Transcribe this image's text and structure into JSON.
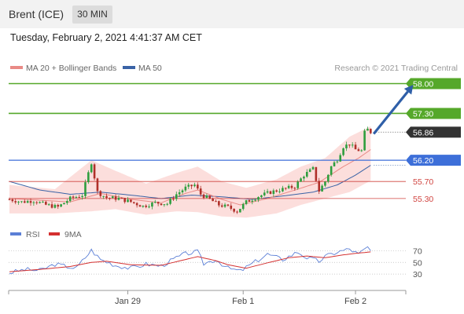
{
  "header": {
    "instrument": "Brent (ICE)",
    "timeframe": "30 MIN"
  },
  "datetime": "Tuesday, February 2, 2021 4:41:37 AM CET",
  "legend": {
    "ma20_bb": "MA 20 + Bollinger Bands",
    "ma50": "MA 50",
    "credit": "Research © 2021 Trading Central"
  },
  "rsi_legend": {
    "rsi": "RSI",
    "ma9": "9MA"
  },
  "colors": {
    "bull": "#2e9e3e",
    "bear": "#b0302a",
    "ma20": "#e98a86",
    "bb_fill": "#fbd8d6",
    "ma50": "#3a63a6",
    "target": "#55a82a",
    "pivot": "#3d6fd9",
    "support": "#d0433f",
    "arrow": "#2f5fa8",
    "rsi": "#5b7fd6",
    "rsi_ma": "#d43030",
    "last_price": "#333333"
  },
  "chart_data": {
    "type": "candlestick",
    "price_axis": {
      "min": 54.8,
      "max": 58.12,
      "grid": false
    },
    "x_ticks": [
      {
        "label": "Jan 29",
        "bar": 39
      },
      {
        "label": "Feb 1",
        "bar": 77
      },
      {
        "label": "Feb 2",
        "bar": 114
      }
    ],
    "levels": [
      {
        "value": 58.0,
        "label": "58.00",
        "kind": "target"
      },
      {
        "value": 57.3,
        "label": "57.30",
        "kind": "target"
      },
      {
        "value": 56.86,
        "label": "56.86",
        "kind": "last"
      },
      {
        "value": 56.2,
        "label": "56.20",
        "kind": "pivot"
      },
      {
        "value": 55.7,
        "label": "55.70",
        "kind": "support"
      },
      {
        "value": 55.3,
        "label": "55.30",
        "kind": "support"
      }
    ],
    "forecast_arrow": {
      "from": {
        "bar": 120,
        "price": 56.82
      },
      "to": {
        "bar": 133,
        "price": 57.97
      }
    },
    "anchors": [
      [
        0,
        55.28
      ],
      [
        4,
        55.22
      ],
      [
        8,
        55.25
      ],
      [
        12,
        55.15
      ],
      [
        16,
        55.1
      ],
      [
        20,
        55.3
      ],
      [
        24,
        55.38
      ],
      [
        27,
        56.15
      ],
      [
        29,
        55.45
      ],
      [
        32,
        55.32
      ],
      [
        36,
        55.3
      ],
      [
        40,
        55.22
      ],
      [
        44,
        55.12
      ],
      [
        48,
        55.2
      ],
      [
        52,
        55.18
      ],
      [
        55,
        55.4
      ],
      [
        58,
        55.55
      ],
      [
        61,
        55.62
      ],
      [
        63,
        55.4
      ],
      [
        66,
        55.28
      ],
      [
        69,
        55.15
      ],
      [
        72,
        55.1
      ],
      [
        75,
        55.0
      ],
      [
        78,
        55.22
      ],
      [
        82,
        55.35
      ],
      [
        86,
        55.45
      ],
      [
        90,
        55.52
      ],
      [
        94,
        55.58
      ],
      [
        97,
        55.85
      ],
      [
        100,
        56.0
      ],
      [
        102,
        55.48
      ],
      [
        104,
        55.7
      ],
      [
        106,
        56.05
      ],
      [
        108,
        56.22
      ],
      [
        110,
        56.52
      ],
      [
        112,
        56.58
      ],
      [
        114,
        56.45
      ],
      [
        116,
        56.42
      ],
      [
        117,
        56.85
      ],
      [
        118,
        56.92
      ],
      [
        119,
        56.86
      ]
    ],
    "ma20": [
      [
        0,
        55.3
      ],
      [
        20,
        55.22
      ],
      [
        30,
        55.42
      ],
      [
        40,
        55.28
      ],
      [
        50,
        55.2
      ],
      [
        58,
        55.42
      ],
      [
        62,
        55.5
      ],
      [
        70,
        55.28
      ],
      [
        76,
        55.15
      ],
      [
        85,
        55.3
      ],
      [
        95,
        55.52
      ],
      [
        102,
        55.68
      ],
      [
        110,
        56.05
      ],
      [
        115,
        56.25
      ],
      [
        119,
        56.45
      ]
    ],
    "ma50": [
      [
        0,
        55.7
      ],
      [
        10,
        55.5
      ],
      [
        20,
        55.4
      ],
      [
        30,
        55.45
      ],
      [
        40,
        55.38
      ],
      [
        50,
        55.3
      ],
      [
        60,
        55.38
      ],
      [
        70,
        55.34
      ],
      [
        80,
        55.28
      ],
      [
        90,
        55.36
      ],
      [
        100,
        55.45
      ],
      [
        108,
        55.62
      ],
      [
        114,
        55.85
      ],
      [
        119,
        56.08
      ]
    ],
    "bb_upper": [
      [
        0,
        55.62
      ],
      [
        15,
        55.52
      ],
      [
        27,
        56.2
      ],
      [
        35,
        55.95
      ],
      [
        45,
        55.65
      ],
      [
        55,
        55.9
      ],
      [
        62,
        56.05
      ],
      [
        70,
        55.7
      ],
      [
        78,
        55.55
      ],
      [
        88,
        55.75
      ],
      [
        96,
        56.05
      ],
      [
        104,
        56.25
      ],
      [
        112,
        56.75
      ],
      [
        119,
        57.0
      ]
    ],
    "bb_lower": [
      [
        0,
        54.95
      ],
      [
        15,
        54.95
      ],
      [
        27,
        55.0
      ],
      [
        35,
        55.05
      ],
      [
        45,
        54.92
      ],
      [
        55,
        55.0
      ],
      [
        62,
        54.98
      ],
      [
        70,
        54.88
      ],
      [
        78,
        54.85
      ],
      [
        88,
        54.95
      ],
      [
        96,
        55.15
      ],
      [
        104,
        55.3
      ],
      [
        112,
        55.45
      ],
      [
        119,
        55.72
      ]
    ],
    "rsi_axis": {
      "min": 10,
      "max": 80,
      "ticks": [
        70,
        50,
        30
      ]
    },
    "rsi": [
      [
        0,
        32
      ],
      [
        5,
        38
      ],
      [
        10,
        36
      ],
      [
        15,
        47
      ],
      [
        22,
        40
      ],
      [
        27,
        71
      ],
      [
        30,
        55
      ],
      [
        35,
        45
      ],
      [
        40,
        40
      ],
      [
        45,
        47
      ],
      [
        50,
        44
      ],
      [
        55,
        58
      ],
      [
        58,
        65
      ],
      [
        62,
        68
      ],
      [
        64,
        48
      ],
      [
        68,
        55
      ],
      [
        72,
        40
      ],
      [
        76,
        35
      ],
      [
        80,
        48
      ],
      [
        85,
        64
      ],
      [
        90,
        55
      ],
      [
        95,
        68
      ],
      [
        98,
        58
      ],
      [
        102,
        52
      ],
      [
        104,
        60
      ],
      [
        108,
        68
      ],
      [
        112,
        73
      ],
      [
        115,
        64
      ],
      [
        118,
        76
      ],
      [
        119,
        70
      ]
    ],
    "rsi_ma": [
      [
        0,
        34
      ],
      [
        10,
        38
      ],
      [
        20,
        43
      ],
      [
        27,
        50
      ],
      [
        32,
        52
      ],
      [
        40,
        46
      ],
      [
        50,
        45
      ],
      [
        58,
        55
      ],
      [
        62,
        60
      ],
      [
        68,
        53
      ],
      [
        72,
        46
      ],
      [
        78,
        40
      ],
      [
        84,
        48
      ],
      [
        92,
        58
      ],
      [
        98,
        61
      ],
      [
        104,
        58
      ],
      [
        110,
        63
      ],
      [
        115,
        66
      ],
      [
        119,
        68
      ]
    ]
  }
}
